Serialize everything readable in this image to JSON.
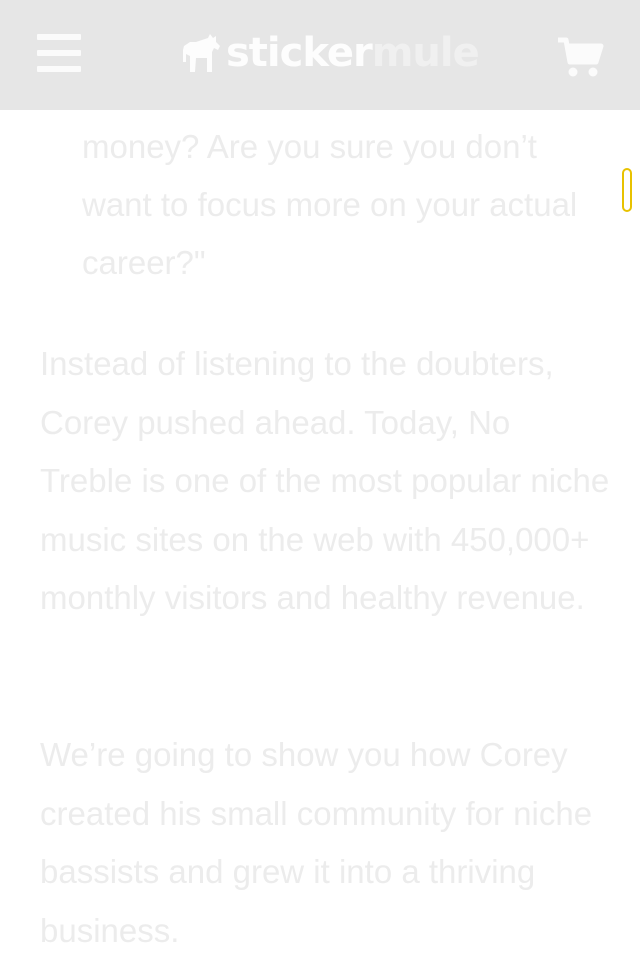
{
  "header": {
    "logo_part1": "sticker",
    "logo_part2": "mule",
    "menu_icon": "hamburger-menu-icon",
    "cart_icon": "shopping-cart-icon",
    "logo_icon": "mule-logo-icon"
  },
  "article": {
    "quote_text": "money? Are you sure you don’t want to focus more on your actual career?\"",
    "paragraphs": [
      "Instead of listening to the doubters, Corey pushed ahead. Today, No Treble is one of the most popular niche music sites on the web with 450,000+ monthly visitors and healthy revenue.",
      "We’re going to show you how Corey created his small community for niche bassists and grew it into a thriving business."
    ]
  },
  "colors": {
    "header_bg": "#e6e6e6",
    "text": "#ececec",
    "scroll_accent": "#e8c200"
  }
}
